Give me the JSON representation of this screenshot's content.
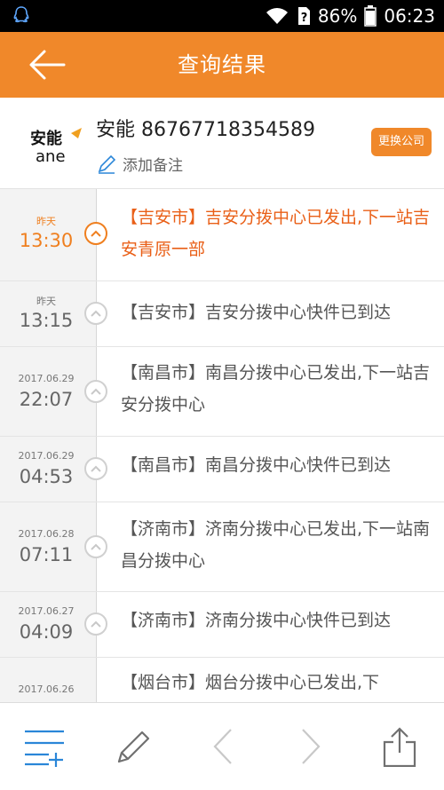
{
  "status_bar": {
    "battery": "86%",
    "time": "06:23"
  },
  "app_bar": {
    "title": "查询结果"
  },
  "header": {
    "company_name": "安能",
    "tracking_number": "86767718354589",
    "add_note_label": "添加备注",
    "change_company_label": "更换公司",
    "logo_text": "安能",
    "logo_subtext": "ane"
  },
  "timeline": [
    {
      "date": "昨天",
      "time": "13:30",
      "text": "【吉安市】吉安分拨中心已发出,下一站吉安青原一部",
      "active": true
    },
    {
      "date": "昨天",
      "time": "13:15",
      "text": "【吉安市】吉安分拨中心快件已到达"
    },
    {
      "date": "2017.06.29",
      "time": "22:07",
      "text": "【南昌市】南昌分拨中心已发出,下一站吉安分拨中心"
    },
    {
      "date": "2017.06.29",
      "time": "04:53",
      "text": "【南昌市】南昌分拨中心快件已到达"
    },
    {
      "date": "2017.06.28",
      "time": "07:11",
      "text": "【济南市】济南分拨中心已发出,下一站南昌分拨中心"
    },
    {
      "date": "2017.06.27",
      "time": "04:09",
      "text": "【济南市】济南分拨中心快件已到达"
    },
    {
      "date": "2017.06.26",
      "time": "",
      "text": "【烟台市】烟台分拨中心已发出,下"
    }
  ],
  "colors": {
    "accent": "#f0882a",
    "active_text": "#e95f17"
  },
  "bottom_bar": {
    "icons": [
      "list-add-icon",
      "edit-icon",
      "prev-icon",
      "next-icon",
      "share-icon"
    ]
  }
}
